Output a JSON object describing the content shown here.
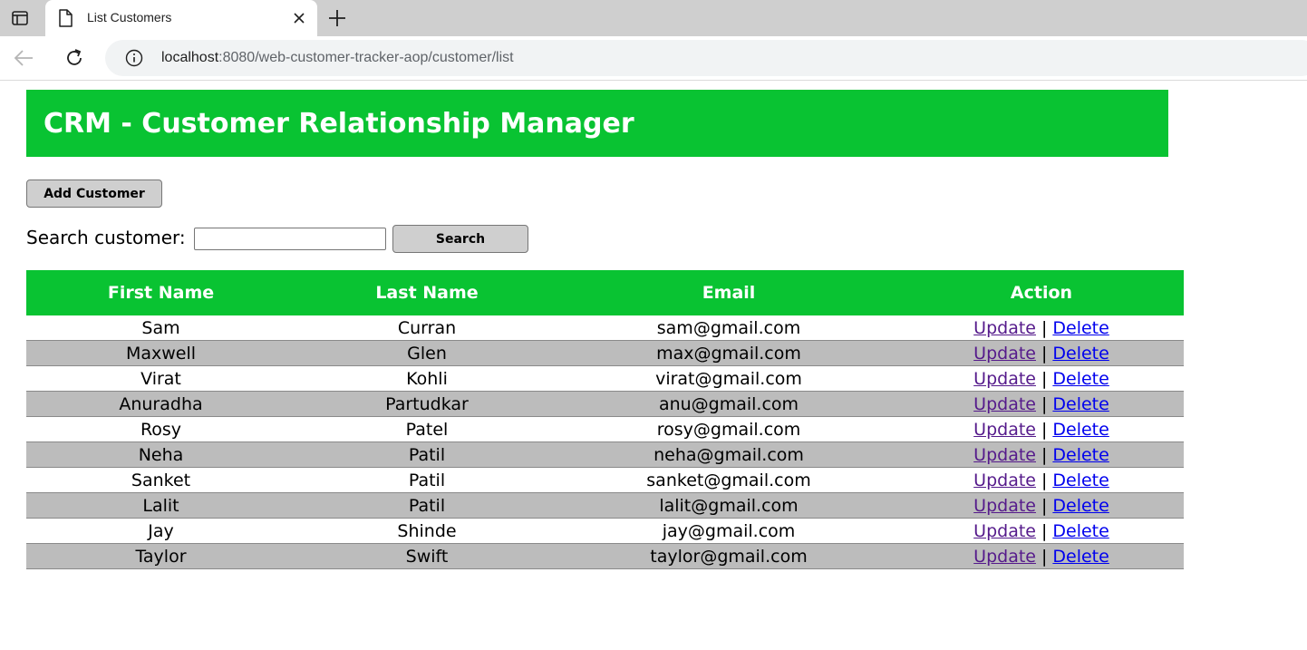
{
  "browser": {
    "tab_title": "List Customers",
    "url_host": "localhost",
    "url_rest": ":8080/web-customer-tracker-aop/customer/list",
    "icons": [
      "tab-strip-icon",
      "page-icon",
      "close-icon",
      "plus-icon",
      "back-arrow-icon",
      "reload-icon",
      "info-icon"
    ]
  },
  "header": {
    "title": "CRM - Customer Relationship Manager",
    "color": "#09c332"
  },
  "actions": {
    "add_label": "Add Customer"
  },
  "search": {
    "label": "Search customer:",
    "value": "",
    "button_label": "Search"
  },
  "table": {
    "columns": [
      "First Name",
      "Last Name",
      "Email",
      "Action"
    ],
    "update_label": "Update",
    "separator": "|",
    "delete_label": "Delete",
    "rows": [
      {
        "first": "Sam",
        "last": "Curran",
        "email": "sam@gmail.com"
      },
      {
        "first": "Maxwell",
        "last": "Glen",
        "email": "max@gmail.com"
      },
      {
        "first": "Virat",
        "last": "Kohli",
        "email": "virat@gmail.com"
      },
      {
        "first": "Anuradha",
        "last": "Partudkar",
        "email": "anu@gmail.com"
      },
      {
        "first": "Rosy",
        "last": "Patel",
        "email": "rosy@gmail.com"
      },
      {
        "first": "Neha",
        "last": "Patil",
        "email": "neha@gmail.com"
      },
      {
        "first": "Sanket",
        "last": "Patil",
        "email": "sanket@gmail.com"
      },
      {
        "first": "Lalit",
        "last": "Patil",
        "email": "lalit@gmail.com"
      },
      {
        "first": "Jay",
        "last": "Shinde",
        "email": "jay@gmail.com"
      },
      {
        "first": "Taylor",
        "last": "Swift",
        "email": "taylor@gmail.com"
      }
    ]
  }
}
